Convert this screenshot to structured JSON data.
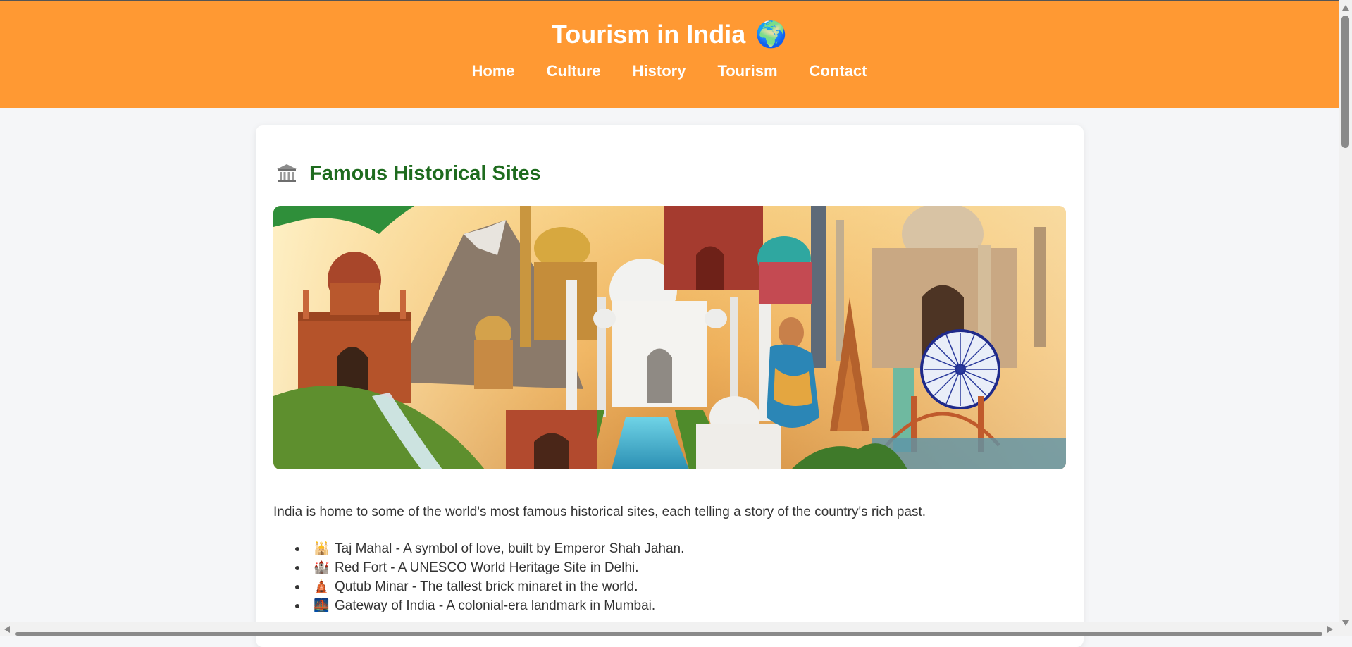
{
  "header": {
    "title": "Tourism in India",
    "title_icon": "🌍",
    "nav": [
      "Home",
      "Culture",
      "History",
      "Tourism",
      "Contact"
    ],
    "background_color": "#ff9933"
  },
  "section": {
    "heading": "Famous Historical Sites",
    "heading_icon": "landmark-icon",
    "heading_color": "#1e6b1e",
    "intro": "India is home to some of the world's most famous historical sites, each telling a story of the country's rich past.",
    "sites": [
      {
        "icon": "🕌",
        "text": "Taj Mahal - A symbol of love, built by Emperor Shah Jahan."
      },
      {
        "icon": "🏰",
        "text": "Red Fort - A UNESCO World Heritage Site in Delhi."
      },
      {
        "icon": "🛕",
        "text": "Qutub Minar - The tallest brick minaret in the world."
      },
      {
        "icon": "🌉",
        "text": "Gateway of India - A colonial-era landmark in Mumbai."
      }
    ]
  }
}
